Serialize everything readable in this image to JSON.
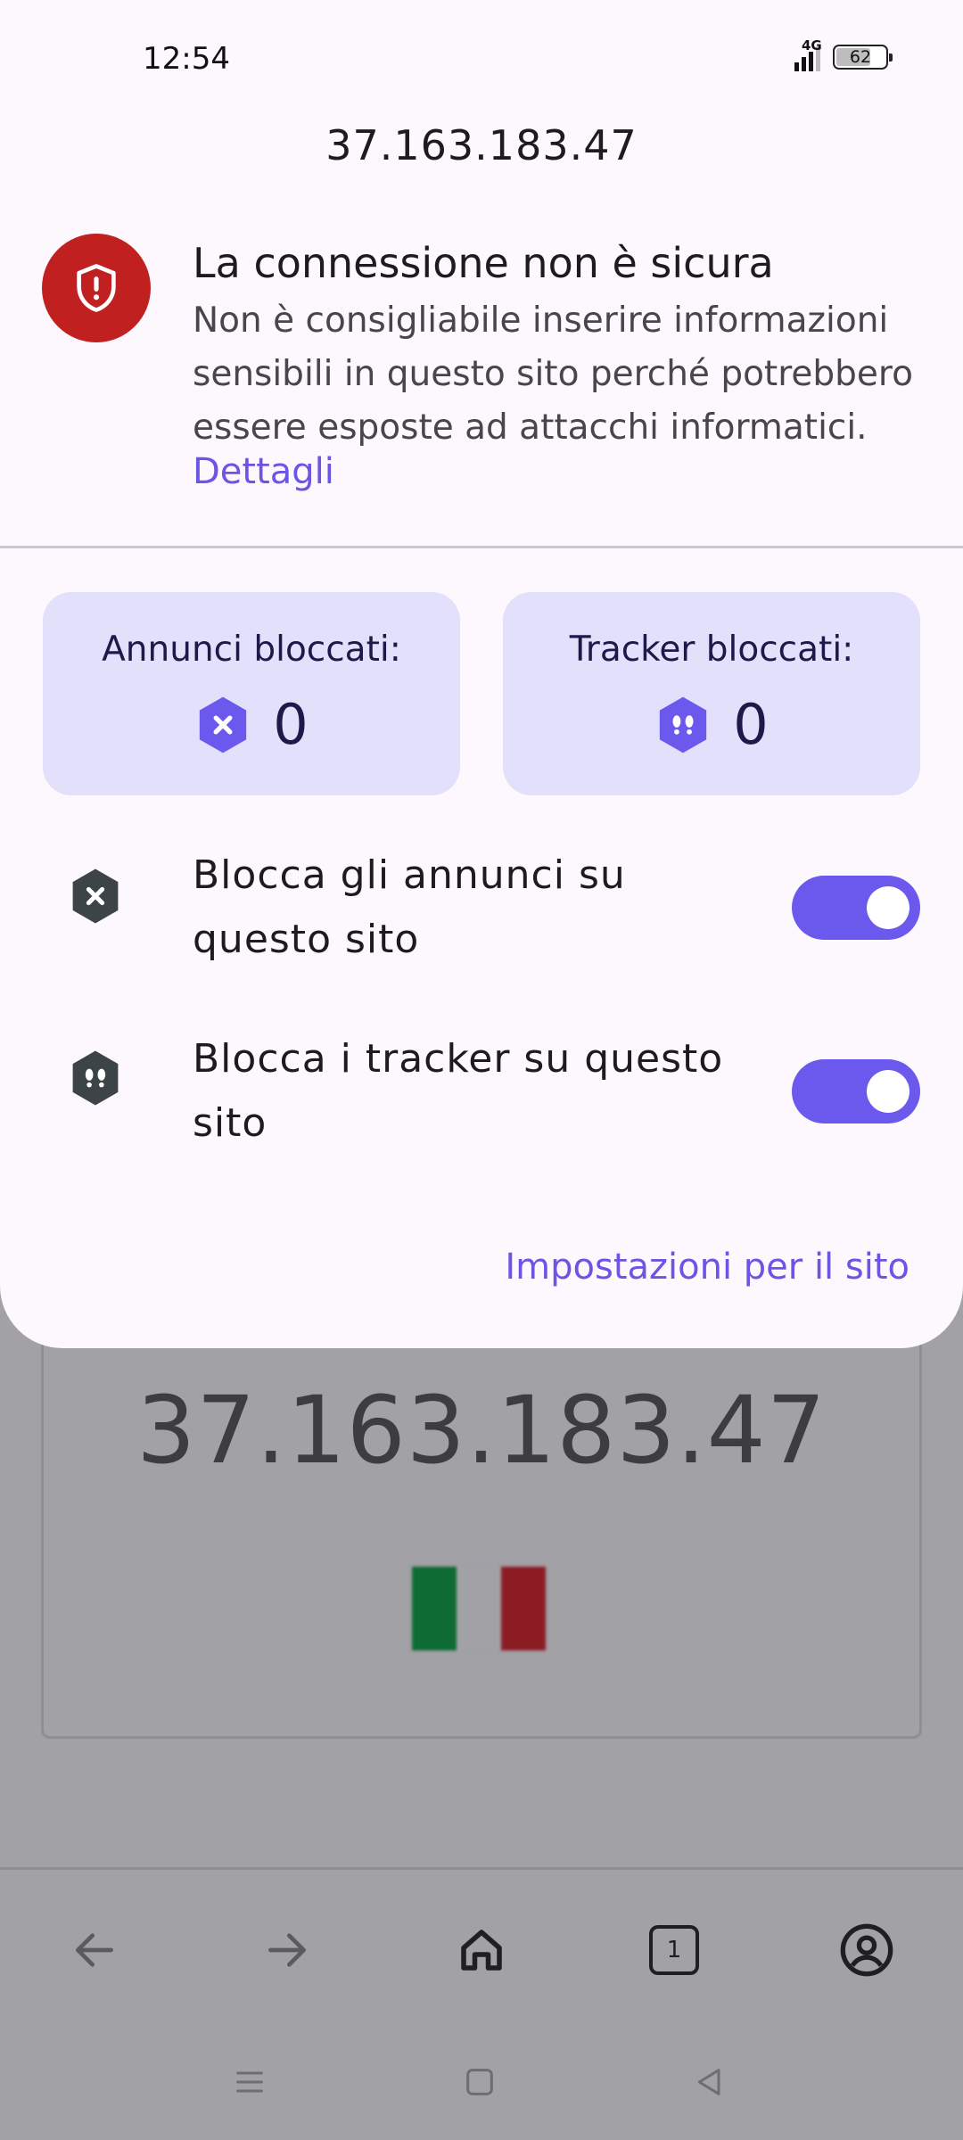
{
  "status_bar": {
    "time": "12:54",
    "network": "4G",
    "battery": "62"
  },
  "sheet": {
    "title": "37.163.183.47",
    "security": {
      "icon": "shield-alert-icon",
      "title": "La connessione non è sicura",
      "description": "Non è consigliabile inserire informazioni sensibili in questo sito perché potrebbero essere esposte ad attacchi informatici.",
      "details_link": "Dettagli"
    },
    "stats": [
      {
        "label": "Annunci bloccati:",
        "value": "0",
        "icon": "ad-block-icon"
      },
      {
        "label": "Tracker bloccati:",
        "value": "0",
        "icon": "tracker-block-icon"
      }
    ],
    "toggles": [
      {
        "label": "Blocca gli annunci su questo sito",
        "enabled": true,
        "icon": "ad-block-icon"
      },
      {
        "label": "Blocca i tracker su questo sito",
        "enabled": true,
        "icon": "tracker-block-icon"
      }
    ],
    "site_settings_link": "Impostazioni per il sito"
  },
  "background_page": {
    "ip": "37.163.183.47",
    "flag_colors": [
      "#0e6b33",
      "#e8e8e8",
      "#8c1c24"
    ]
  },
  "bottom_nav": {
    "tab_count": "1",
    "items": [
      "back-icon",
      "forward-icon",
      "home-icon",
      "tabs-icon",
      "account-icon"
    ]
  },
  "colors": {
    "accent": "#6b58ec",
    "danger": "#c0201f",
    "card_bg": "#e2e0fb"
  }
}
